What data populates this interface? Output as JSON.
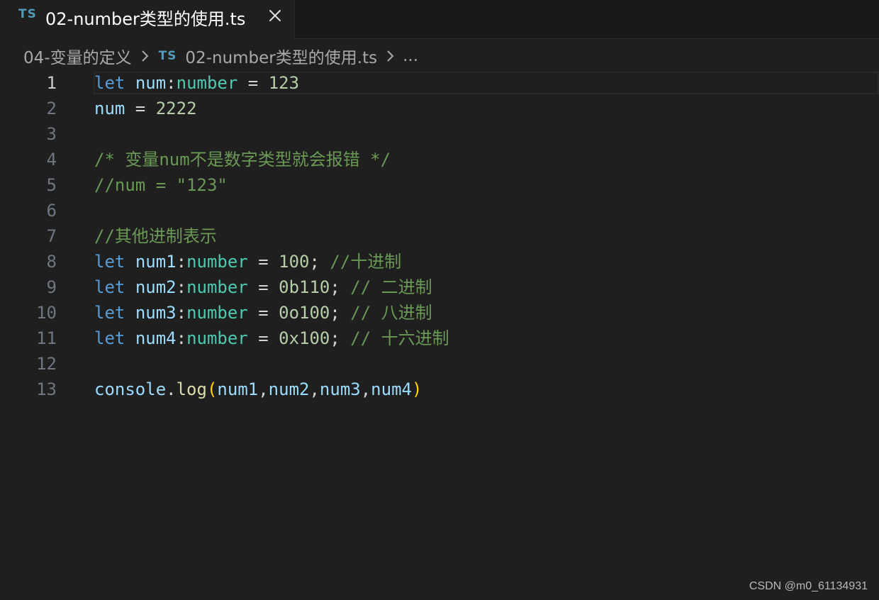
{
  "tab": {
    "icon_text": "TS",
    "title": "02-number类型的使用.ts",
    "close_icon": "close-icon"
  },
  "breadcrumb": {
    "folder": "04-变量的定义",
    "file_icon_text": "TS",
    "file": "02-number类型的使用.ts",
    "more": "..."
  },
  "editor": {
    "active_line": 1,
    "lines": [
      {
        "n": "1",
        "tokens": [
          [
            "kw",
            "let"
          ],
          [
            "op",
            " "
          ],
          [
            "var",
            "num"
          ],
          [
            "op",
            ":"
          ],
          [
            "type",
            "number"
          ],
          [
            "op",
            " = "
          ],
          [
            "num",
            "123"
          ]
        ]
      },
      {
        "n": "2",
        "tokens": [
          [
            "var",
            "num"
          ],
          [
            "op",
            " = "
          ],
          [
            "num",
            "2222"
          ]
        ]
      },
      {
        "n": "3",
        "tokens": []
      },
      {
        "n": "4",
        "tokens": [
          [
            "cmt",
            "/* 变量num不是数字类型就会报错 */"
          ]
        ]
      },
      {
        "n": "5",
        "tokens": [
          [
            "cmt",
            "//num = \"123\""
          ]
        ]
      },
      {
        "n": "6",
        "tokens": []
      },
      {
        "n": "7",
        "tokens": [
          [
            "cmt",
            "//其他进制表示"
          ]
        ]
      },
      {
        "n": "8",
        "tokens": [
          [
            "kw",
            "let"
          ],
          [
            "op",
            " "
          ],
          [
            "var",
            "num1"
          ],
          [
            "op",
            ":"
          ],
          [
            "type",
            "number"
          ],
          [
            "op",
            " = "
          ],
          [
            "num",
            "100"
          ],
          [
            "op",
            "; "
          ],
          [
            "cmt",
            "//十进制"
          ]
        ]
      },
      {
        "n": "9",
        "tokens": [
          [
            "kw",
            "let"
          ],
          [
            "op",
            " "
          ],
          [
            "var",
            "num2"
          ],
          [
            "op",
            ":"
          ],
          [
            "type",
            "number"
          ],
          [
            "op",
            " = "
          ],
          [
            "num",
            "0b110"
          ],
          [
            "op",
            "; "
          ],
          [
            "cmt",
            "// 二进制"
          ]
        ]
      },
      {
        "n": "10",
        "tokens": [
          [
            "kw",
            "let"
          ],
          [
            "op",
            " "
          ],
          [
            "var",
            "num3"
          ],
          [
            "op",
            ":"
          ],
          [
            "type",
            "number"
          ],
          [
            "op",
            " = "
          ],
          [
            "num",
            "0o100"
          ],
          [
            "op",
            "; "
          ],
          [
            "cmt",
            "// 八进制"
          ]
        ]
      },
      {
        "n": "11",
        "tokens": [
          [
            "kw",
            "let"
          ],
          [
            "op",
            " "
          ],
          [
            "var",
            "num4"
          ],
          [
            "op",
            ":"
          ],
          [
            "type",
            "number"
          ],
          [
            "op",
            " = "
          ],
          [
            "num",
            "0x100"
          ],
          [
            "op",
            "; "
          ],
          [
            "cmt",
            "// 十六进制"
          ]
        ]
      },
      {
        "n": "12",
        "tokens": []
      },
      {
        "n": "13",
        "tokens": [
          [
            "var",
            "console"
          ],
          [
            "op",
            "."
          ],
          [
            "fn",
            "log"
          ],
          [
            "par",
            "("
          ],
          [
            "var",
            "num1"
          ],
          [
            "op",
            ","
          ],
          [
            "var",
            "num2"
          ],
          [
            "op",
            ","
          ],
          [
            "var",
            "num3"
          ],
          [
            "op",
            ","
          ],
          [
            "var",
            "num4"
          ],
          [
            "par",
            ")"
          ]
        ]
      }
    ]
  },
  "watermark": "CSDN @m0_61134931",
  "colors": {
    "background": "#1f1f1f",
    "tab_bar": "#181818",
    "keyword": "#569cd6",
    "variable": "#9cdcfe",
    "type": "#4ec9b0",
    "number": "#b5cea8",
    "comment": "#6a9955",
    "function": "#dcdcaa",
    "bracket": "#ffd700"
  }
}
